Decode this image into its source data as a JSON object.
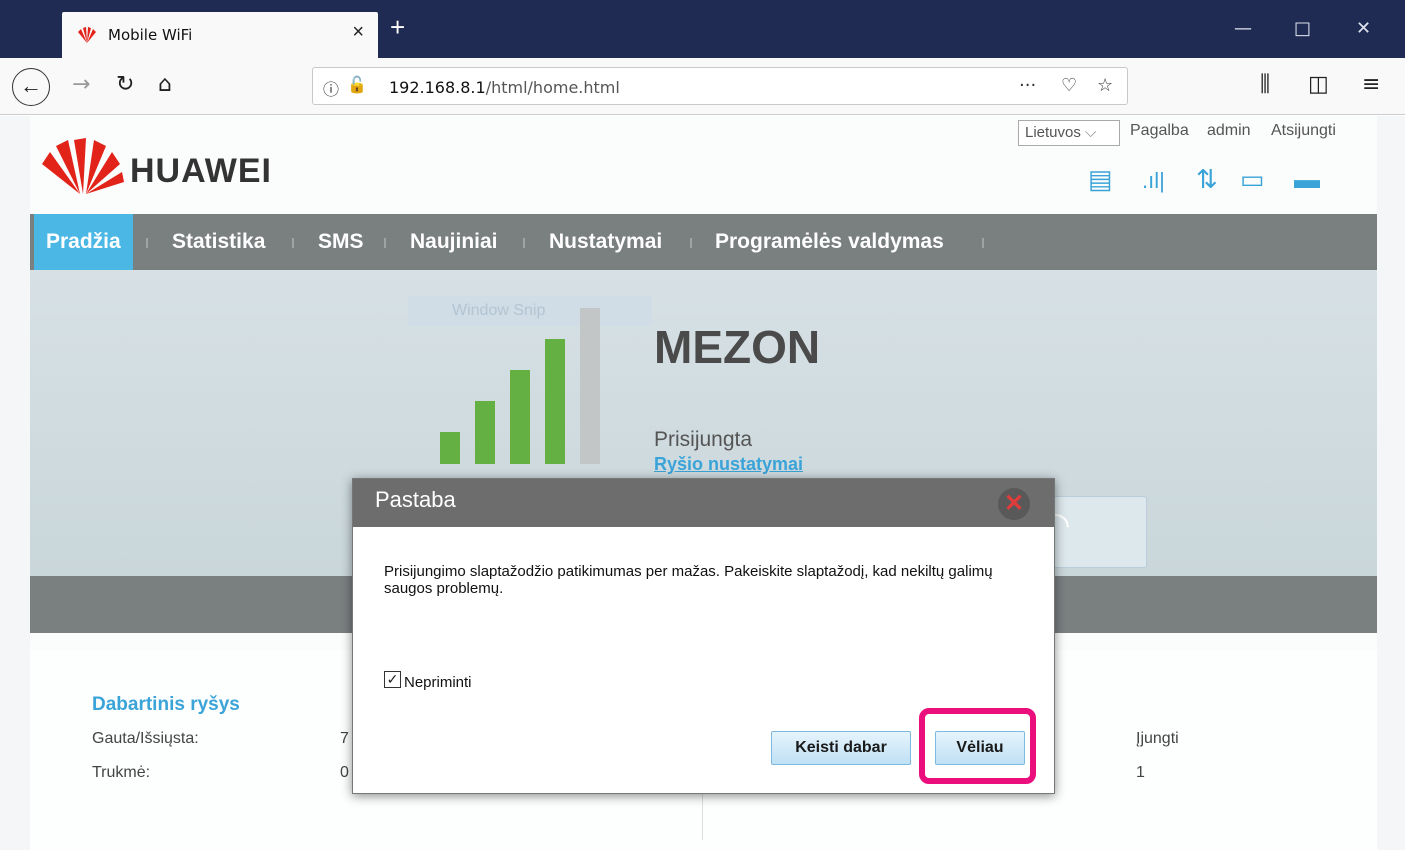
{
  "browser": {
    "tab_title": "Mobile WiFi",
    "url_host": "192.168.8.1",
    "url_path": "/html/home.html"
  },
  "header": {
    "brand": "HUAWEI",
    "language": "Lietuvos",
    "links": [
      "Pagalba",
      "admin",
      "Atsijungti"
    ]
  },
  "menu": {
    "items": [
      "Pradžia",
      "Statistika",
      "SMS",
      "Naujiniai",
      "Nustatymai",
      "Programėlės valdymas"
    ],
    "active_index": 0
  },
  "hero": {
    "ghost_text": "Window Snip",
    "isp": "MEZON",
    "status": "Prisijungta",
    "settings_link": "Ryšio nustatymai",
    "signal_bars_active": 4,
    "signal_bars_total": 5
  },
  "connection": {
    "title": "Dabartinis ryšys",
    "received_sent_label": "Gauta/Išsiųsta:",
    "received_sent_value": "7",
    "duration_label": "Trukmė:",
    "duration_value": "0",
    "right_value_1": "Įjungti",
    "right_value_2": "1"
  },
  "dialog": {
    "title": "Pastaba",
    "message": "Prisijungimo slaptažodžio patikimumas per mažas. Pakeiskite slaptažodį, kad nekiltų galimų saugos problemų.",
    "checkbox_label": "Nepriminti",
    "checkbox_checked": true,
    "change_now": "Keisti dabar",
    "later": "Vėliau"
  },
  "colors": {
    "accent": "#4bb7e5",
    "highlight": "#ea0f7c",
    "signal": "#64b042"
  }
}
